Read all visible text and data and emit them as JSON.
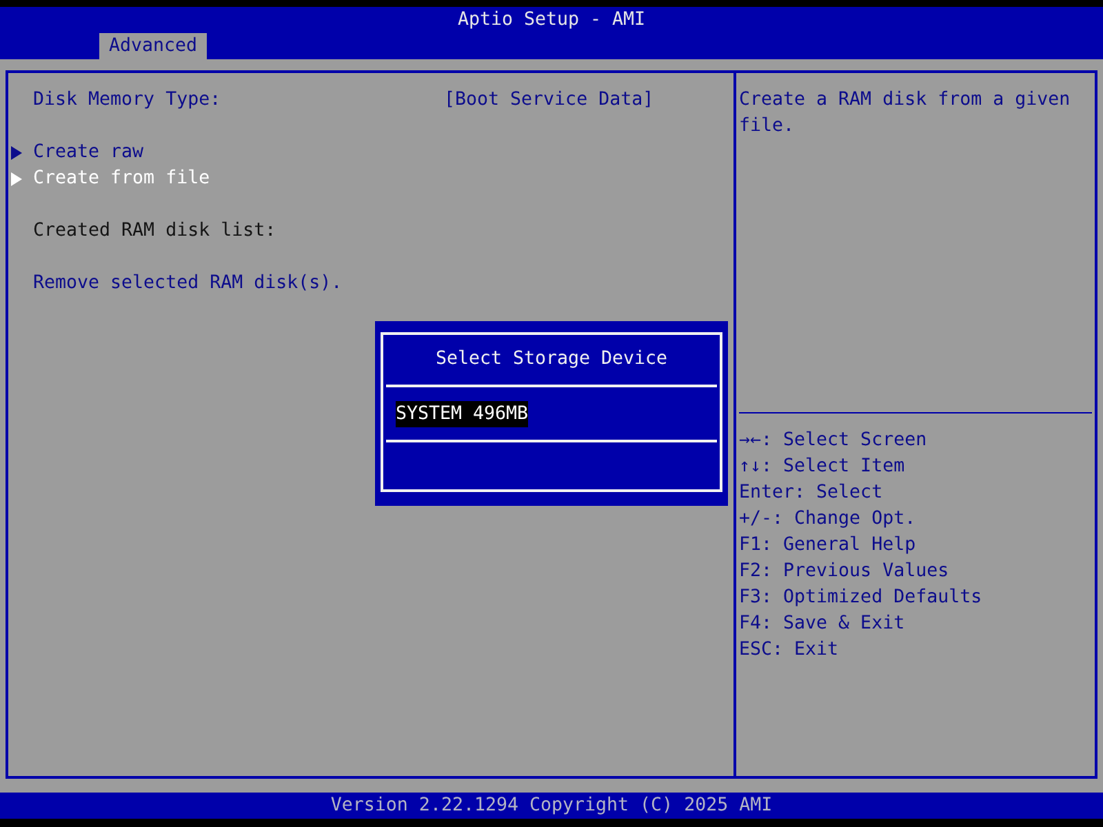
{
  "window": {
    "title": "Aptio Setup - AMI"
  },
  "tabs": [
    {
      "label": "Advanced",
      "selected": true
    }
  ],
  "left_panel": {
    "groups": [
      [
        {
          "kind": "setting",
          "label": "Disk Memory Type:",
          "value": "[Boot Service Data]"
        }
      ],
      [
        {
          "kind": "submenu",
          "label": "Create raw",
          "selected": false
        },
        {
          "kind": "submenu",
          "label": "Create from file",
          "selected": true
        }
      ],
      [
        {
          "kind": "heading",
          "label": "Created RAM disk list:"
        }
      ],
      [
        {
          "kind": "action",
          "label": "Remove selected RAM disk(s)."
        }
      ]
    ]
  },
  "popup": {
    "title": "Select Storage Device",
    "options": [
      {
        "label": "SYSTEM 496MB",
        "selected": true
      }
    ]
  },
  "help_panel": {
    "description": "Create a RAM disk from a given file.",
    "keys": [
      "→←: Select Screen",
      "↑↓: Select Item",
      "Enter: Select",
      "+/-: Change Opt.",
      "F1: General Help",
      "F2: Previous Values",
      "F3: Optimized Defaults",
      "F4: Save & Exit",
      "ESC: Exit"
    ]
  },
  "status_bar": {
    "text": "Version 2.22.1294 Copyright (C) 2025 AMI"
  }
}
